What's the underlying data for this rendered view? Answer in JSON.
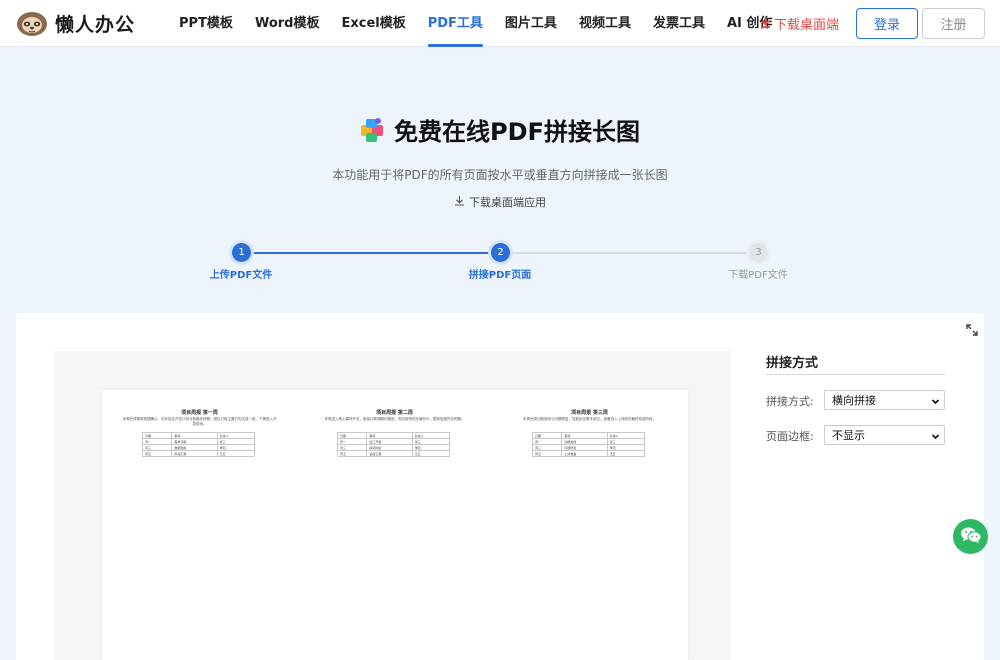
{
  "header": {
    "logo_text": "懒人办公",
    "nav": [
      {
        "label": "PPT模板"
      },
      {
        "label": "Word模板"
      },
      {
        "label": "Excel模板"
      },
      {
        "label": "PDF工具"
      },
      {
        "label": "图片工具"
      },
      {
        "label": "视频工具"
      },
      {
        "label": "发票工具"
      },
      {
        "label": "AI 创作"
      }
    ],
    "active_nav": "PDF工具",
    "download_label": "下载桌面端",
    "login_label": "登录",
    "register_label": "注册"
  },
  "hero": {
    "title": "免费在线PDF拼接长图",
    "description": "本功能用于将PDF的所有页面按水平或垂直方向拼接成一张长图",
    "download_app_label": "下载桌面端应用"
  },
  "steps": [
    {
      "number": "1",
      "label": "上传PDF文件",
      "state": "done"
    },
    {
      "number": "2",
      "label": "拼接PDF页面",
      "state": "current"
    },
    {
      "number": "3",
      "label": "下载PDF文件",
      "state": "todo"
    }
  ],
  "preview": {
    "pages": [
      {
        "title": "项目周报 第一周",
        "text": "本周完成需求梳理确认，初步拟定开发计划与各模块排期，团队已就主要方向达成一致，下周进入开发阶段。",
        "rows": [
          [
            "日期",
            "事项",
            "负责人"
          ],
          [
            "周一",
            "需求评审",
            "张三"
          ],
          [
            "周三",
            "数据建模",
            "李四"
          ],
          [
            "周五",
            "阶段汇报",
            "王五"
          ]
        ]
      },
      {
        "title": "项目周报 第二周",
        "text": "本周进入核心模块开发，各接口联调顺利推进，测试用例同步编写中，整体进度符合预期。",
        "rows": [
          [
            "日期",
            "事项",
            "负责人"
          ],
          [
            "周一",
            "接口开发",
            "张三"
          ],
          [
            "周三",
            "联调测试",
            "李四"
          ],
          [
            "周五",
            "进度汇报",
            "王五"
          ]
        ]
      },
      {
        "title": "项目周报 第三周",
        "text": "本周完成功能验收与问题修复，性能优化基本到位，准备进入上线前的最终检查阶段。",
        "rows": [
          [
            "日期",
            "事项",
            "负责人"
          ],
          [
            "周一",
            "功能验收",
            "张三"
          ],
          [
            "周三",
            "问题修复",
            "李四"
          ],
          [
            "周五",
            "上线准备",
            "王五"
          ]
        ]
      }
    ]
  },
  "settings": {
    "title": "拼接方式",
    "mode_label": "拼接方式:",
    "mode_value": "横向拼接",
    "border_label": "页面边框:",
    "border_value": "不显示"
  },
  "colors": {
    "accent": "#2a6fd6",
    "download_red": "#e04848",
    "wechat_green": "#2fb863"
  }
}
